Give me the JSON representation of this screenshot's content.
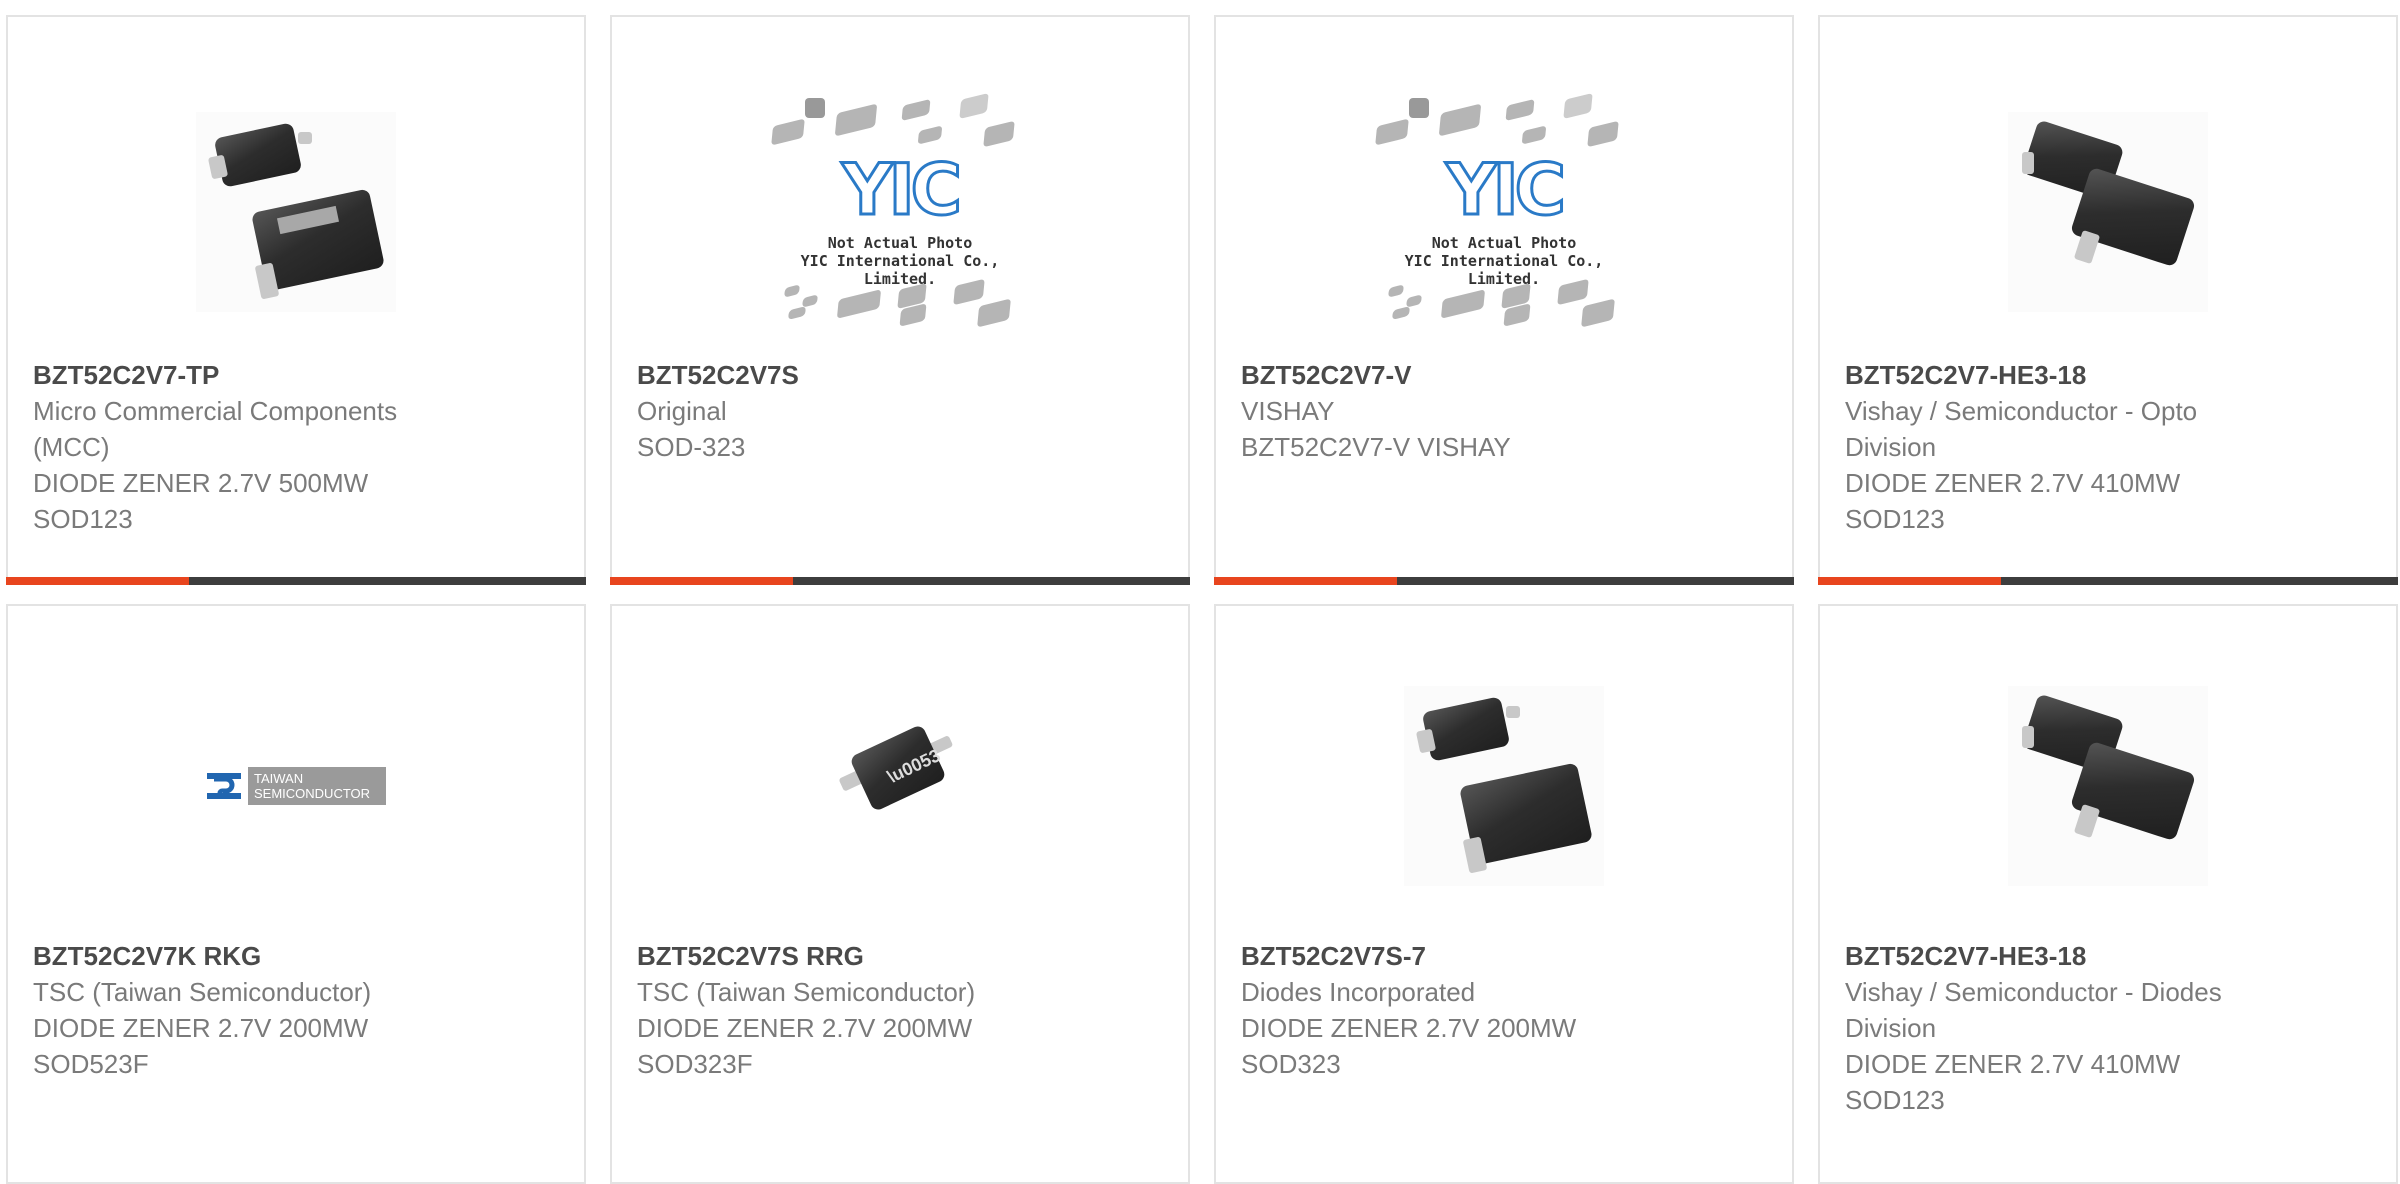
{
  "products": [
    {
      "part": "BZT52C2V7-TP",
      "lines": [
        "Micro Commercial Components",
        "(MCC)",
        "DIODE ZENER 2.7V 500MW",
        "SOD123"
      ],
      "image": "diode-photo-icon"
    },
    {
      "part": "BZT52C2V7S",
      "lines": [
        "Original",
        "SOD-323"
      ],
      "image": "yic-placeholder-icon"
    },
    {
      "part": "BZT52C2V7-V",
      "lines": [
        "VISHAY",
        "BZT52C2V7-V VISHAY"
      ],
      "image": "yic-placeholder-icon"
    },
    {
      "part": "BZT52C2V7-HE3-18",
      "lines": [
        "Vishay / Semiconductor - Opto",
        "Division",
        "DIODE ZENER 2.7V 410MW",
        "SOD123"
      ],
      "image": "diode-photo-icon"
    },
    {
      "part": "BZT52C2V7K RKG",
      "lines": [
        "TSC (Taiwan Semiconductor)",
        "DIODE ZENER 2.7V 200MW",
        "SOD523F"
      ],
      "image": "taiwan-semiconductor-logo"
    },
    {
      "part": "BZT52C2V7S RRG",
      "lines": [
        "TSC (Taiwan Semiconductor)",
        "DIODE ZENER 2.7V 200MW",
        "SOD323F"
      ],
      "image": "diode-photo-icon"
    },
    {
      "part": "BZT52C2V7S-7",
      "lines": [
        "Diodes Incorporated",
        "DIODE ZENER 2.7V 200MW",
        "SOD323"
      ],
      "image": "diode-photo-icon"
    },
    {
      "part": "BZT52C2V7-HE3-18",
      "lines": [
        "Vishay / Semiconductor - Diodes",
        "Division",
        "DIODE ZENER 2.7V 410MW",
        "SOD123"
      ],
      "image": "diode-photo-icon"
    }
  ],
  "placeholder": {
    "logo": "YIC",
    "note_line1": "Not Actual Photo",
    "note_line2": "YIC International Co., Limited."
  },
  "tsc_logo": {
    "line1": "TAIWAN",
    "line2": "SEMICONDUCTOR"
  },
  "colors": {
    "accent": "#e8451e",
    "bar": "#3d3d3d",
    "part_text": "#4a4a4a",
    "body_text": "#7a7a7a",
    "border": "#e3e3e3"
  }
}
